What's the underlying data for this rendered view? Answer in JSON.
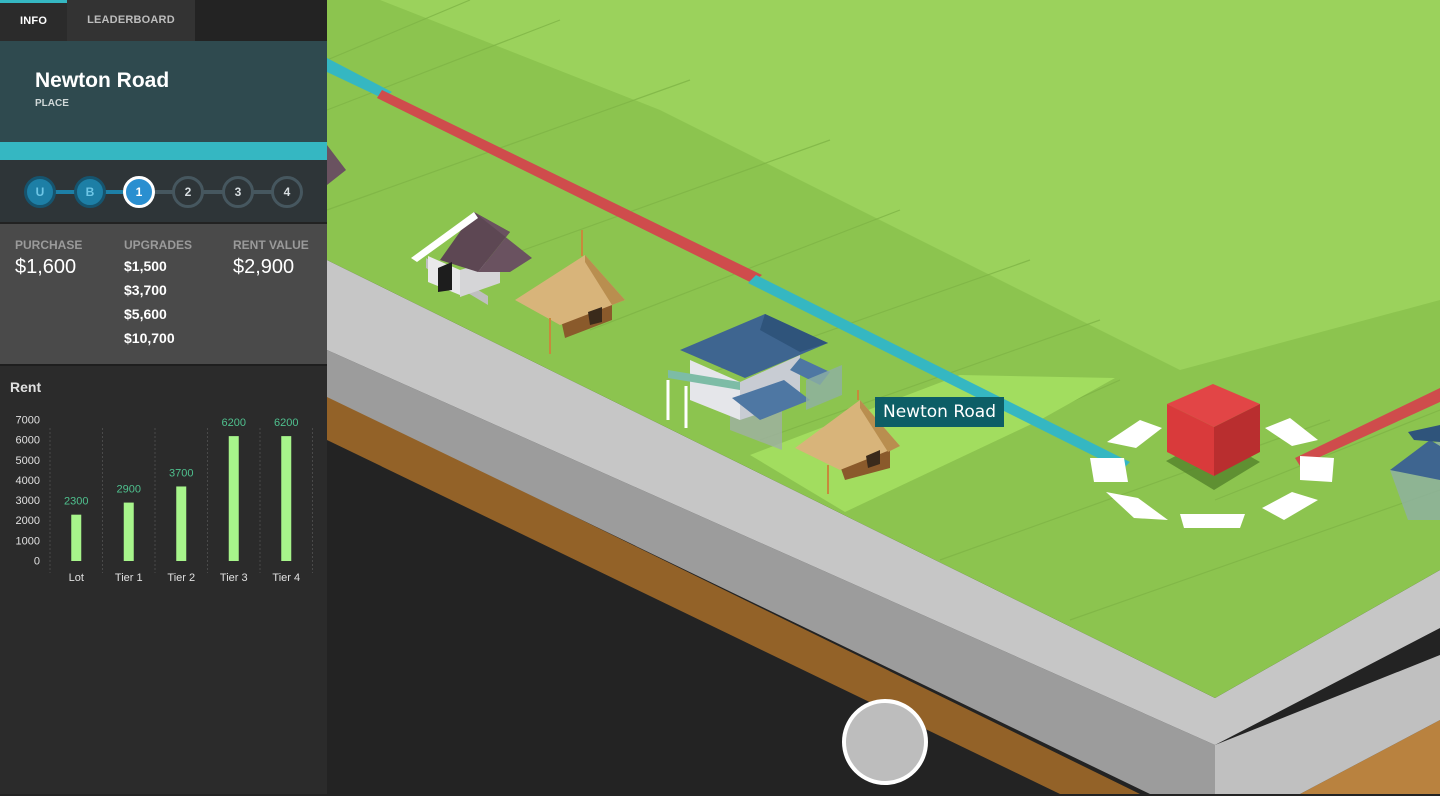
{
  "tabs": [
    {
      "label": "INFO",
      "active": true
    },
    {
      "label": "LEADERBOARD",
      "active": false
    }
  ],
  "place": {
    "name": "Newton Road",
    "type": "PLACE",
    "accent_color": "#35b7c2"
  },
  "tiers": [
    {
      "label": "U",
      "state": "done"
    },
    {
      "label": "B",
      "state": "done"
    },
    {
      "label": "1",
      "state": "current"
    },
    {
      "label": "2",
      "state": "todo"
    },
    {
      "label": "3",
      "state": "todo"
    },
    {
      "label": "4",
      "state": "todo"
    }
  ],
  "stats": {
    "purchase_label": "PURCHASE",
    "purchase_value": "$1,600",
    "upgrades_label": "UPGRADES",
    "upgrades": [
      "$1,500",
      "$3,700",
      "$5,600",
      "$10,700"
    ],
    "rent_label": "RENT VALUE",
    "rent_value": "$2,900"
  },
  "rent_section": {
    "title": "Rent"
  },
  "chart_data": {
    "type": "bar",
    "title": "Rent",
    "categories": [
      "Lot",
      "Tier 1",
      "Tier 2",
      "Tier 3",
      "Tier 4"
    ],
    "values": [
      2300,
      2900,
      3700,
      6200,
      6200
    ],
    "ylim": [
      0,
      7000
    ],
    "yticks": [
      0,
      1000,
      2000,
      3000,
      4000,
      5000,
      6000,
      7000
    ],
    "bar_color": "#a7f58b",
    "label_color": "#4fc08e",
    "grid": "vertical dotted separators"
  },
  "board": {
    "tooltip_label": "Newton Road",
    "player_token_color": "#d93a3b"
  }
}
